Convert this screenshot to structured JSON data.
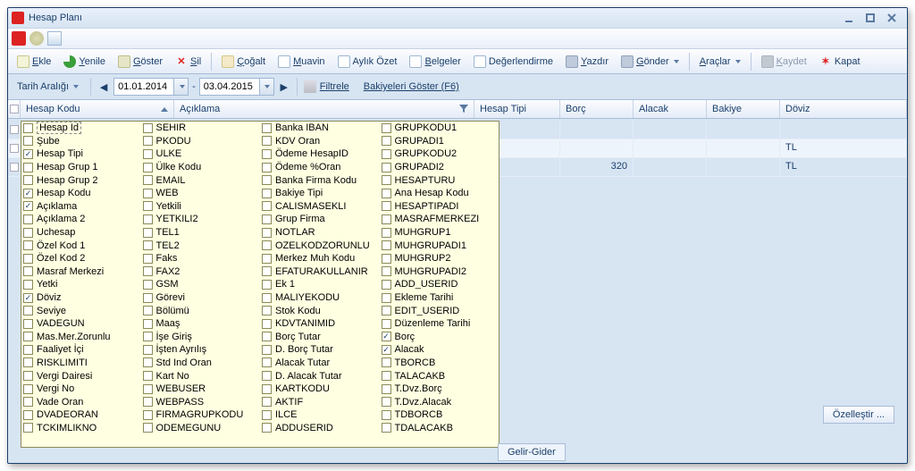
{
  "window": {
    "title": "Hesap Planı"
  },
  "toolbar": {
    "ekle": "Ekle",
    "yenile": "Yenile",
    "goster": "Göster",
    "sil": "Sil",
    "cogalt": "Çoğalt",
    "muavin": "Muavin",
    "aylikozet": "Aylık Özet",
    "belgeler": "Belgeler",
    "degerlendirme": "Değerlendirme",
    "yazdir": "Yazdır",
    "gonder": "Gönder",
    "araclar": "Araçlar",
    "kaydet": "Kaydet",
    "kapat": "Kapat"
  },
  "filterbar": {
    "taraligi": "Tarih Aralığı",
    "date_from": "01.01.2014",
    "date_to": "03.04.2015",
    "filtrele": "Filtrele",
    "bakiyeleri": "Bakiyeleri Göster (F6)"
  },
  "columns": {
    "hesapkodu": "Hesap Kodu",
    "aciklama": "Açıklama",
    "hesaptipi": "Hesap Tipi",
    "borc": "Borç",
    "alacak": "Alacak",
    "bakiye": "Bakiye",
    "doviz": "Döviz"
  },
  "rows": [
    {
      "borc": "",
      "doviz": "TL"
    },
    {
      "borc": "320",
      "doviz": "TL"
    }
  ],
  "tab": "Gelir-Gider",
  "ozellestir": "Özelleştir ...",
  "chooser": {
    "col1": [
      {
        "l": "Hesap Id",
        "c": false,
        "dashed": true
      },
      {
        "l": "Şube",
        "c": false
      },
      {
        "l": "Hesap Tipi",
        "c": true
      },
      {
        "l": "Hesap Grup 1",
        "c": false
      },
      {
        "l": "Hesap Grup 2",
        "c": false
      },
      {
        "l": "Hesap Kodu",
        "c": true
      },
      {
        "l": "Açıklama",
        "c": true
      },
      {
        "l": "Açıklama 2",
        "c": false
      },
      {
        "l": "Uchesap",
        "c": false
      },
      {
        "l": "Özel Kod 1",
        "c": false
      },
      {
        "l": "Özel Kod 2",
        "c": false
      },
      {
        "l": "Masraf Merkezi",
        "c": false
      },
      {
        "l": "Yetki",
        "c": false
      },
      {
        "l": "Döviz",
        "c": true
      },
      {
        "l": "Seviye",
        "c": false
      },
      {
        "l": "VADEGUN",
        "c": false
      },
      {
        "l": "Mas.Mer.Zorunlu",
        "c": false
      },
      {
        "l": "Faaliyet İçi",
        "c": false
      },
      {
        "l": "RISKLIMITI",
        "c": false
      },
      {
        "l": "Vergi Dairesi",
        "c": false
      },
      {
        "l": "Vergi No",
        "c": false
      },
      {
        "l": "Vade Oran",
        "c": false
      },
      {
        "l": "DVADEORAN",
        "c": false
      },
      {
        "l": "TCKIMLIKNO",
        "c": false
      }
    ],
    "col2": [
      {
        "l": "SEHIR",
        "c": false
      },
      {
        "l": "PKODU",
        "c": false
      },
      {
        "l": "ULKE",
        "c": false
      },
      {
        "l": "Ülke Kodu",
        "c": false
      },
      {
        "l": "EMAIL",
        "c": false
      },
      {
        "l": "WEB",
        "c": false
      },
      {
        "l": "Yetkili",
        "c": false
      },
      {
        "l": "YETKILI2",
        "c": false
      },
      {
        "l": "TEL1",
        "c": false
      },
      {
        "l": "TEL2",
        "c": false
      },
      {
        "l": "Faks",
        "c": false
      },
      {
        "l": "FAX2",
        "c": false
      },
      {
        "l": "GSM",
        "c": false
      },
      {
        "l": "Görevi",
        "c": false
      },
      {
        "l": "Bölümü",
        "c": false
      },
      {
        "l": "Maaş",
        "c": false
      },
      {
        "l": "İşe Giriş",
        "c": false
      },
      {
        "l": "İşten Ayrılış",
        "c": false
      },
      {
        "l": "Std Ind Oran",
        "c": false
      },
      {
        "l": "Kart No",
        "c": false
      },
      {
        "l": "WEBUSER",
        "c": false
      },
      {
        "l": "WEBPASS",
        "c": false
      },
      {
        "l": "FIRMAGRUPKODU",
        "c": false
      },
      {
        "l": "ODEMEGUNU",
        "c": false
      }
    ],
    "col3": [
      {
        "l": "Banka IBAN",
        "c": false
      },
      {
        "l": "KDV Oran",
        "c": false
      },
      {
        "l": "Ödeme HesapID",
        "c": false
      },
      {
        "l": "Ödeme %Oran",
        "c": false
      },
      {
        "l": "Banka Firma Kodu",
        "c": false
      },
      {
        "l": "Bakiye Tipi",
        "c": false
      },
      {
        "l": "CALISMASEKLI",
        "c": false
      },
      {
        "l": "Grup Firma",
        "c": false
      },
      {
        "l": "NOTLAR",
        "c": false
      },
      {
        "l": "OZELKODZORUNLU",
        "c": false
      },
      {
        "l": "Merkez Muh Kodu",
        "c": false
      },
      {
        "l": "EFATURAKULLANIR",
        "c": false
      },
      {
        "l": "Ek 1",
        "c": false
      },
      {
        "l": "MALIYEKODU",
        "c": false
      },
      {
        "l": "Stok Kodu",
        "c": false
      },
      {
        "l": "KDVTANIMID",
        "c": false
      },
      {
        "l": "Borç Tutar",
        "c": false
      },
      {
        "l": "D. Borç Tutar",
        "c": false
      },
      {
        "l": "Alacak Tutar",
        "c": false
      },
      {
        "l": "D. Alacak Tutar",
        "c": false
      },
      {
        "l": "KARTKODU",
        "c": false
      },
      {
        "l": "AKTIF",
        "c": false
      },
      {
        "l": "ILCE",
        "c": false
      },
      {
        "l": "ADDUSERID",
        "c": false
      }
    ],
    "col4": [
      {
        "l": "GRUPKODU1",
        "c": false
      },
      {
        "l": "GRUPADI1",
        "c": false
      },
      {
        "l": "GRUPKODU2",
        "c": false
      },
      {
        "l": "GRUPADI2",
        "c": false
      },
      {
        "l": "HESAPTURU",
        "c": false
      },
      {
        "l": "Ana Hesap Kodu",
        "c": false
      },
      {
        "l": "HESAPTIPADI",
        "c": false
      },
      {
        "l": "MASRAFMERKEZI",
        "c": false
      },
      {
        "l": "MUHGRUP1",
        "c": false
      },
      {
        "l": "MUHGRUPADI1",
        "c": false
      },
      {
        "l": "MUHGRUP2",
        "c": false
      },
      {
        "l": "MUHGRUPADI2",
        "c": false
      },
      {
        "l": "ADD_USERID",
        "c": false
      },
      {
        "l": "Ekleme Tarihi",
        "c": false
      },
      {
        "l": "EDIT_USERID",
        "c": false
      },
      {
        "l": "Düzenleme Tarihi",
        "c": false
      },
      {
        "l": "Borç",
        "c": true
      },
      {
        "l": "Alacak",
        "c": true
      },
      {
        "l": "TBORCB",
        "c": false
      },
      {
        "l": "TALACAKB",
        "c": false
      },
      {
        "l": "T.Dvz.Borç",
        "c": false
      },
      {
        "l": "T.Dvz.Alacak",
        "c": false
      },
      {
        "l": "TDBORCB",
        "c": false
      },
      {
        "l": "TDALACAKB",
        "c": false
      }
    ]
  }
}
